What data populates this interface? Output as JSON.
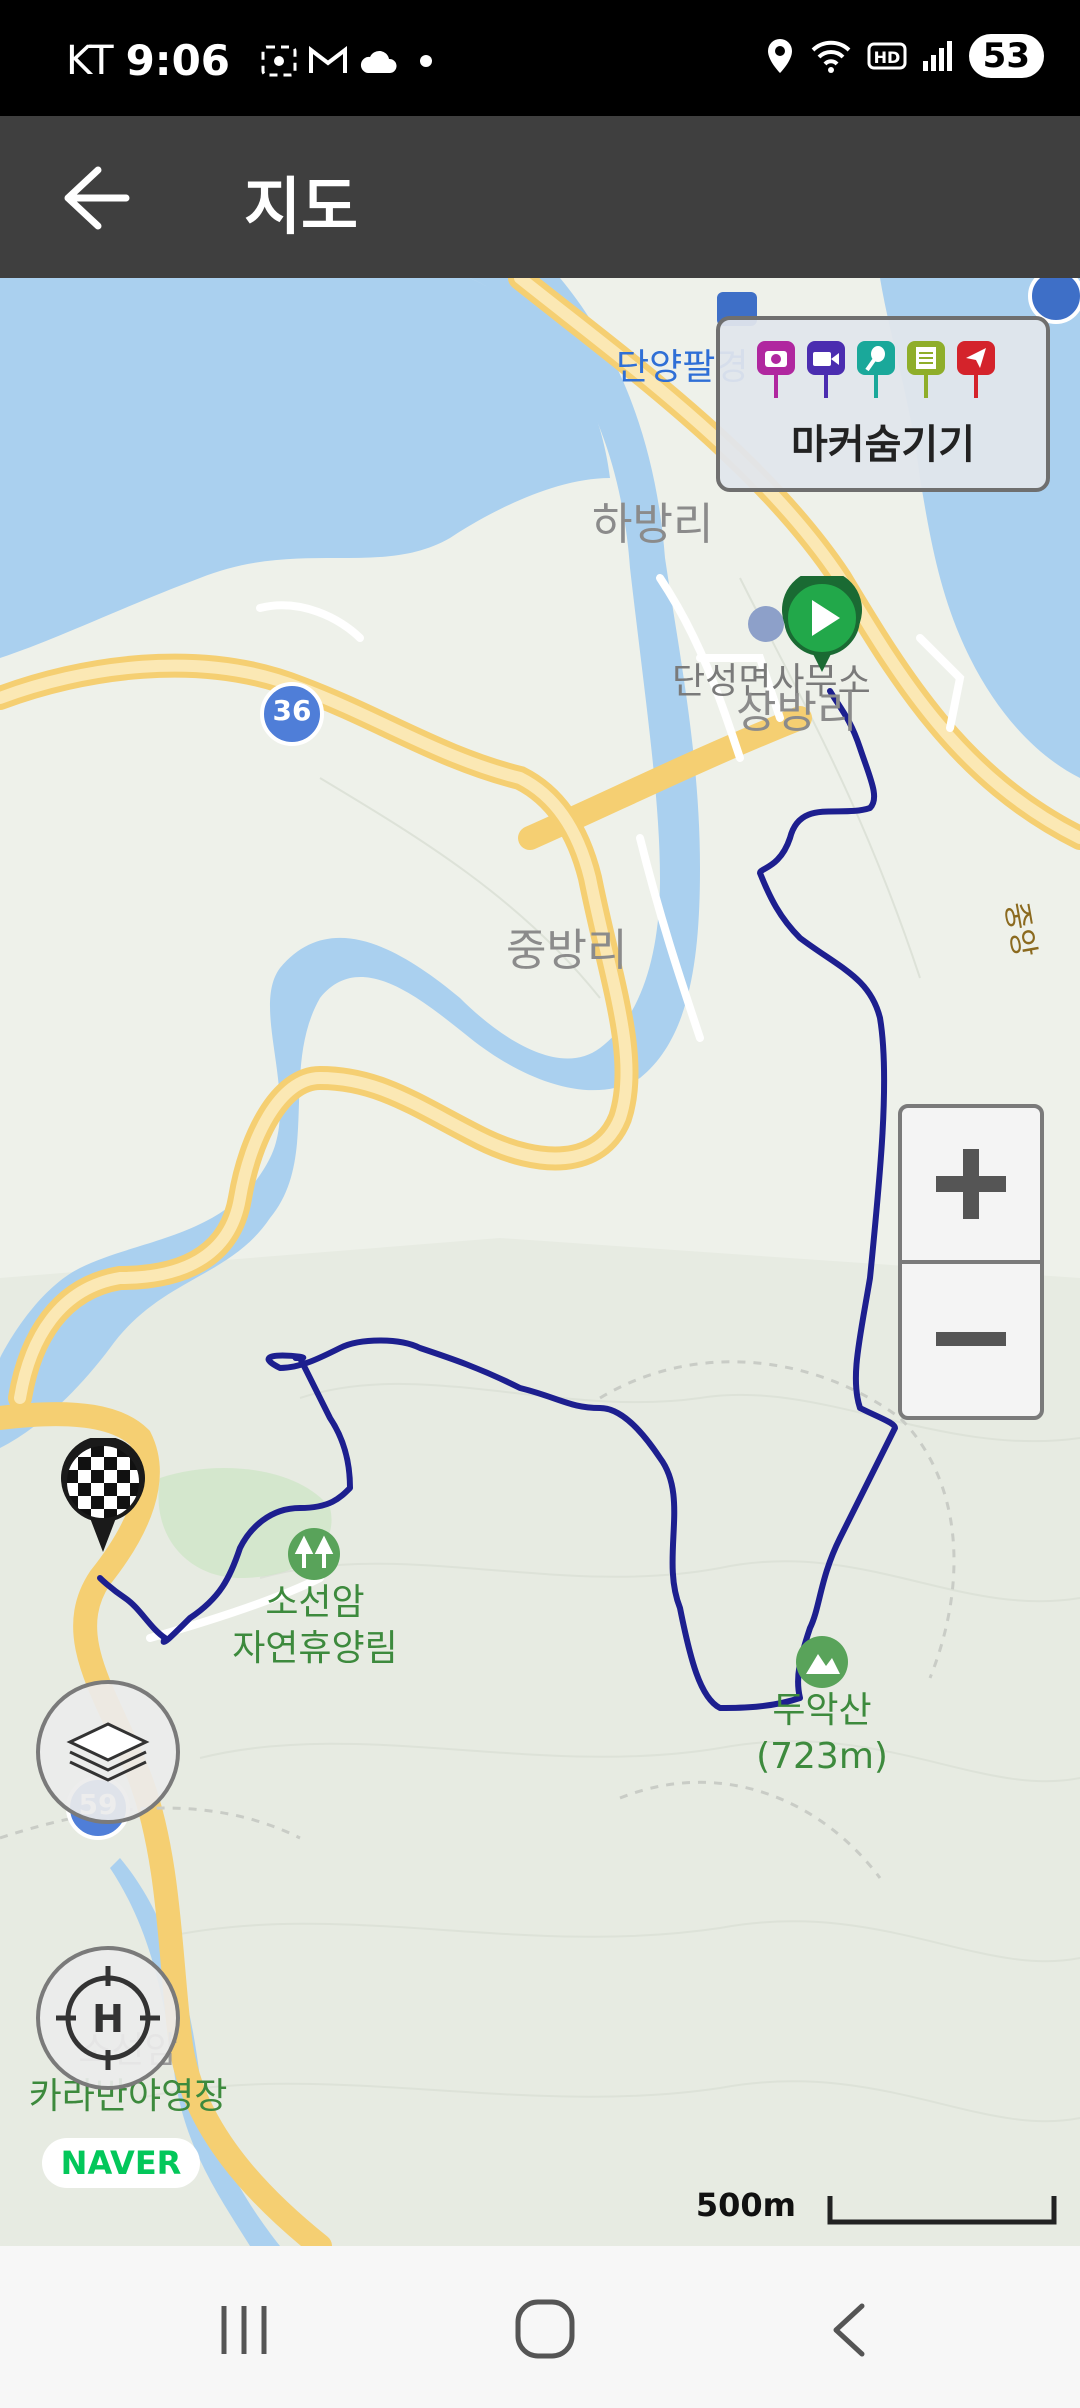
{
  "status_bar": {
    "carrier": "KT",
    "time": "9:06",
    "battery": "53",
    "left_icons": [
      "screenshot-icon",
      "gmail-icon",
      "cloud-icon",
      "dot-icon"
    ],
    "right_icons": [
      "location-icon",
      "wifi-icon",
      "hd-icon",
      "signal-icon"
    ]
  },
  "app_bar": {
    "title": "지도",
    "back_icon": "arrow-left-icon"
  },
  "map": {
    "labels": {
      "danyang_palgyeong": "단양팔경",
      "habangri": "하방리",
      "office": "단성면사무소",
      "sangbangri": "상방리",
      "road_36": "36",
      "jungbangri": "중방리",
      "forest_line1": "소선암",
      "forest_line2": "자연휴양림",
      "mountain_name": "두악산",
      "mountain_height": "(723m)",
      "road_59": "59",
      "campsite_line1": "소선암",
      "campsite_line2": "카라반야영장",
      "road_side": "중앙"
    },
    "marker_panel": {
      "label": "마커숨기기",
      "pins": [
        {
          "icon": "camera-icon",
          "color": "#b0279f"
        },
        {
          "icon": "video-icon",
          "color": "#4b2db0"
        },
        {
          "icon": "microphone-icon",
          "color": "#1aa89a"
        },
        {
          "icon": "memo-icon",
          "color": "#8fae2a"
        },
        {
          "icon": "flag-icon",
          "color": "#d4232b"
        }
      ]
    },
    "zoom": {
      "in_icon": "plus-icon",
      "out_icon": "minus-icon"
    },
    "layers_icon": "layers-icon",
    "home_icon": "helipad-icon",
    "brand": "NAVER",
    "scale_label": "500m",
    "colors": {
      "track": "#1d1f8f",
      "water": "#aad0ef",
      "road": "#f7d98a",
      "start": "#22a84a",
      "land": "#eef1ea"
    },
    "start_marker_icon": "play-icon",
    "end_marker_icon": "checkered-flag-icon"
  },
  "nav_bar": {
    "icons": [
      "recent-apps-icon",
      "home-icon",
      "back-icon"
    ]
  }
}
